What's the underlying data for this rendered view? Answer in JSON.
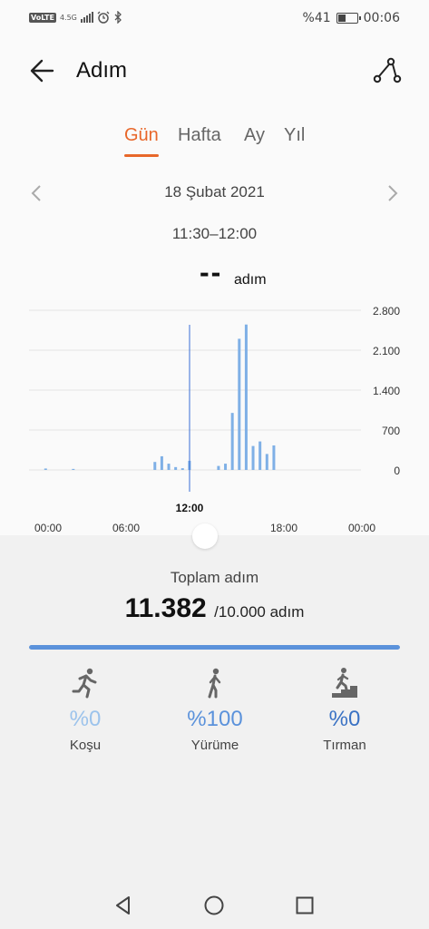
{
  "status_bar": {
    "volte": "VoLTE",
    "network": "4.5G",
    "battery_text": "%41",
    "battery_level": 0.41,
    "time": "00:06",
    "icons": [
      "signal-icon",
      "alarm-icon",
      "bluetooth-icon",
      "battery-icon"
    ]
  },
  "header": {
    "title": "Adım",
    "back_icon": "back-arrow-icon",
    "share_icon": "share-icon"
  },
  "tabs": [
    {
      "label": "Gün",
      "active": true
    },
    {
      "label": "Hafta",
      "active": false
    },
    {
      "label": "Ay",
      "active": false
    },
    {
      "label": "Yıl",
      "active": false
    }
  ],
  "date": {
    "label": "18 Şubat 2021",
    "time_range": "11:30–12:00"
  },
  "reading": {
    "value": "--",
    "unit": "adım"
  },
  "chart_data": {
    "type": "bar",
    "y_ticks": [
      "2.800",
      "2.100",
      "1.400",
      "700",
      "0"
    ],
    "ylim": [
      0,
      2800
    ],
    "x_ticks": [
      "00:00",
      "06:00",
      "12:00",
      "18:00",
      "00:00"
    ],
    "xlim_hours": [
      0,
      24
    ],
    "selected_label": "12:00",
    "selected_hour": 12,
    "bar_color": "#7fb0e6",
    "cursor_color": "#3a6fd6",
    "bars": [
      {
        "hour": 1.2,
        "value": 25
      },
      {
        "hour": 3.2,
        "value": 18
      },
      {
        "hour": 9.1,
        "value": 140
      },
      {
        "hour": 9.6,
        "value": 240
      },
      {
        "hour": 10.1,
        "value": 110
      },
      {
        "hour": 10.6,
        "value": 50
      },
      {
        "hour": 11.1,
        "value": 30
      },
      {
        "hour": 11.6,
        "value": 160
      },
      {
        "hour": 13.7,
        "value": 70
      },
      {
        "hour": 14.2,
        "value": 110
      },
      {
        "hour": 14.7,
        "value": 1000
      },
      {
        "hour": 15.2,
        "value": 2300
      },
      {
        "hour": 15.7,
        "value": 2550
      },
      {
        "hour": 16.2,
        "value": 420
      },
      {
        "hour": 16.7,
        "value": 500
      },
      {
        "hour": 17.2,
        "value": 280
      },
      {
        "hour": 17.7,
        "value": 430
      }
    ]
  },
  "summary": {
    "label": "Toplam adım",
    "total": "11.382",
    "goal": "/10.000 adım",
    "progress": 1.0,
    "progress_color": "#5b92db"
  },
  "activities": [
    {
      "icon": "running-icon",
      "pct": "%0",
      "name": "Koşu",
      "color": "#9cc3ec"
    },
    {
      "icon": "walking-icon",
      "pct": "%100",
      "name": "Yürüme",
      "color": "#5b92db"
    },
    {
      "icon": "climbing-icon",
      "pct": "%0",
      "name": "Tırman",
      "color": "#3a72c4"
    }
  ],
  "nav": {
    "back": "nav-back-icon",
    "home": "nav-home-icon",
    "recent": "nav-recent-icon"
  }
}
